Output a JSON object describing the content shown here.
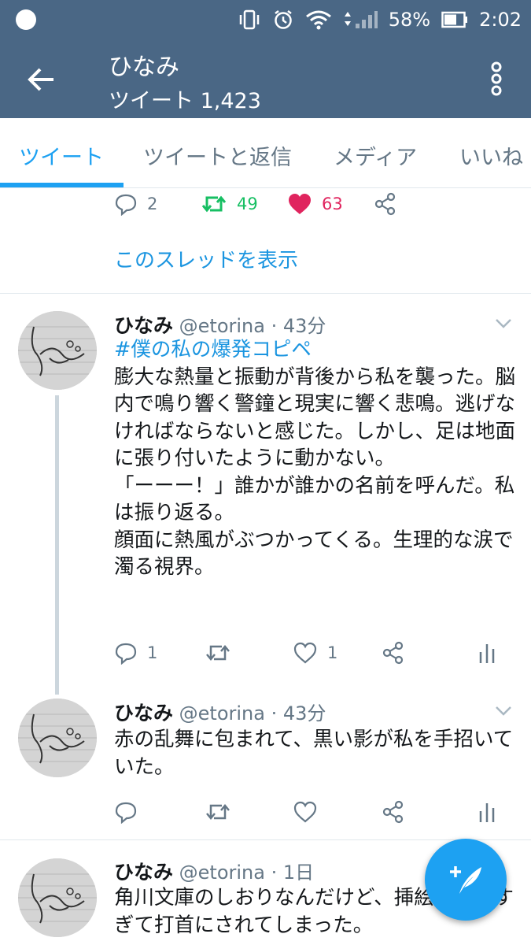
{
  "status_bar": {
    "battery": "58%",
    "time": "2:02"
  },
  "header": {
    "title": "ひなみ",
    "subtitle": "ツイート 1,423"
  },
  "tabs": [
    {
      "label": "ツイート",
      "active": true
    },
    {
      "label": "ツイートと返信"
    },
    {
      "label": "メディア"
    },
    {
      "label": "いいね"
    }
  ],
  "top_tweet": {
    "replies": "2",
    "retweets": "49",
    "likes": "63",
    "thread_link": "このスレッドを表示"
  },
  "tweets": [
    {
      "name": "ひなみ",
      "handle": "@etorina",
      "time": "· 43分",
      "hashtag": "#僕の私の爆発コピペ",
      "text": "膨大な熱量と振動が背後から私を襲った。脳内で鳴り響く警鐘と現実に響く悲鳴。逃げなければならないと感じた。しかし、足は地面に張り付いたように動かない。\n「ーーー！」誰かが誰かの名前を呼んだ。私は振り返る。\n顔面に熱風がぶつかってくる。生理的な涙で濁る視界。",
      "replies": "1",
      "likes": "1"
    },
    {
      "name": "ひなみ",
      "handle": "@etorina",
      "time": "· 43分",
      "text": "赤の乱舞に包まれて、黒い影が私を手招いていた。"
    },
    {
      "name": "ひなみ",
      "handle": "@etorina",
      "time": "· 1日",
      "text": "角川文庫のしおりなんだけど、挿絵がひどすぎて打首にされてしまった。"
    }
  ],
  "colors": {
    "header_bg": "#4a6785",
    "accent": "#1da1f2",
    "retweet": "#17bf63",
    "like": "#e0245e"
  }
}
